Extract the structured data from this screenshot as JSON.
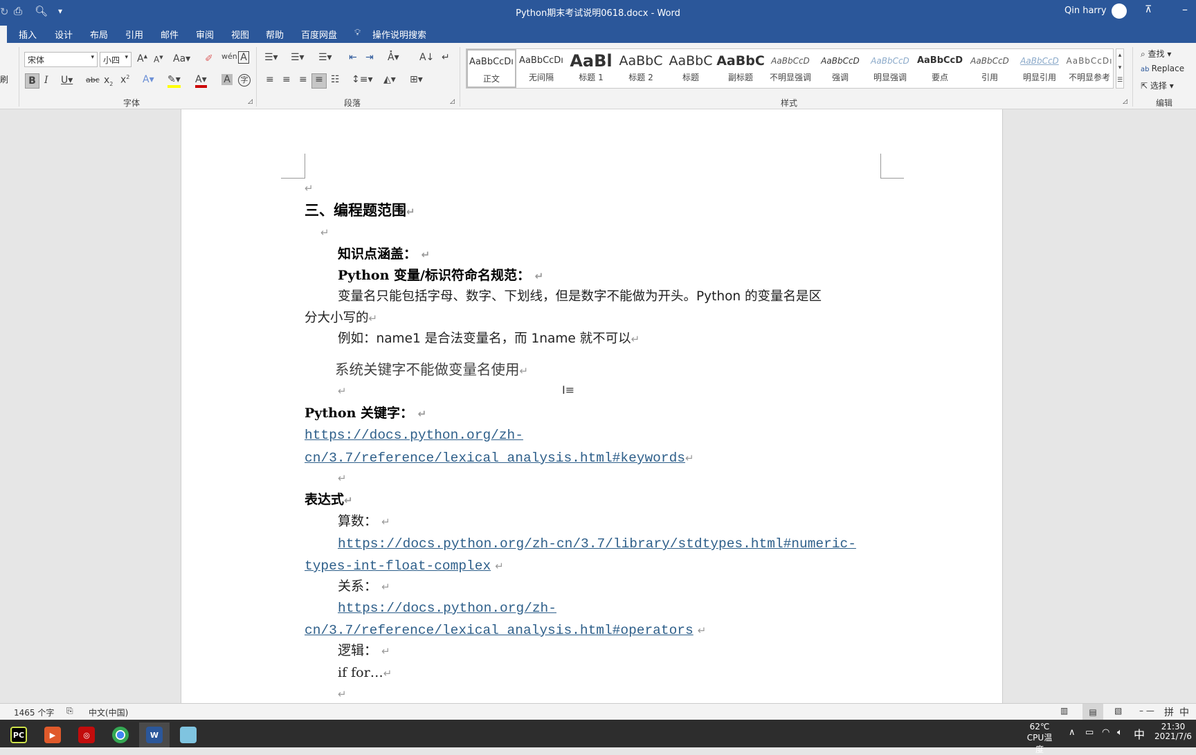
{
  "titlebar": {
    "title": "Python期末考试说明0618.docx  -  Word",
    "user": "Qin harry",
    "qat_more": "▾"
  },
  "tabs": [
    "插入",
    "设计",
    "布局",
    "引用",
    "邮件",
    "审阅",
    "视图",
    "帮助",
    "百度网盘"
  ],
  "tell_me": "操作说明搜索",
  "left_cut": "刷",
  "font": {
    "name": "宋体",
    "size": "小四",
    "group": "字体"
  },
  "paragraph": {
    "group": "段落"
  },
  "styles": {
    "group": "样式",
    "items": [
      {
        "preview": "AaBbCcDı",
        "name": "正文"
      },
      {
        "preview": "AaBbCcDı",
        "name": "无间隔"
      },
      {
        "preview": "AaBl",
        "name": "标题 1"
      },
      {
        "preview": "AaBbC",
        "name": "标题 2"
      },
      {
        "preview": "AaBbC",
        "name": "标题"
      },
      {
        "preview": "AaBbC",
        "name": "副标题"
      },
      {
        "preview": "AaBbCcD",
        "name": "不明显强调"
      },
      {
        "preview": "AaBbCcD",
        "name": "强调"
      },
      {
        "preview": "AaBbCcD",
        "name": "明显强调"
      },
      {
        "preview": "AaBbCcD",
        "name": "要点"
      },
      {
        "preview": "AaBbCcD",
        "name": "引用"
      },
      {
        "preview": "AaBbCcD",
        "name": "明显引用"
      },
      {
        "preview": "AaBbCcDı",
        "name": "不明显参考"
      }
    ]
  },
  "editing": {
    "find": "查找",
    "replace": "Replace",
    "select": "选择",
    "group": "编辑"
  },
  "doc": {
    "h1": "三、编程题范围",
    "kp": "知识点涵盖：",
    "naming": "Python 变量/标识符命名规范：",
    "rule1": "变量名只能包括字母、数字、下划线，但是数字不能做为开头。Python 的变量名是区",
    "rule1b": "分大小写的",
    "example": "例如：name1 是合法变量名，而 1name 就不可以",
    "kw_rule": "系统关键字不能做变量名使用",
    "kw_title": "Python 关键字：",
    "kw_link1": "https://docs.python.org/zh-",
    "kw_link2": "cn/3.7/reference/lexical_analysis.html#keywords",
    "expr": "表达式",
    "arith": "算数：",
    "arith_link1": "https://docs.python.org/zh-cn/3.7/library/stdtypes.html#numeric-",
    "arith_link2": "types-int-float-complex",
    "rel": "关系：",
    "rel_link1": "https://docs.python.org/zh-",
    "rel_link2": "cn/3.7/reference/lexical_analysis.html#operators",
    "logic": "逻辑：",
    "iffor": "if for…",
    "pilcrow": "↵"
  },
  "status": {
    "words": "1465 个字",
    "lang": "中文(中国)"
  },
  "tray": {
    "temp": "62℃",
    "temp_label": "CPU温度",
    "ime": "中",
    "time": "21:30",
    "date": "2021/7/6",
    "ime_mode": "拼",
    "ime_lang": "中"
  },
  "colors": {
    "accent": "#2b579a",
    "link": "#2e5f8a"
  }
}
